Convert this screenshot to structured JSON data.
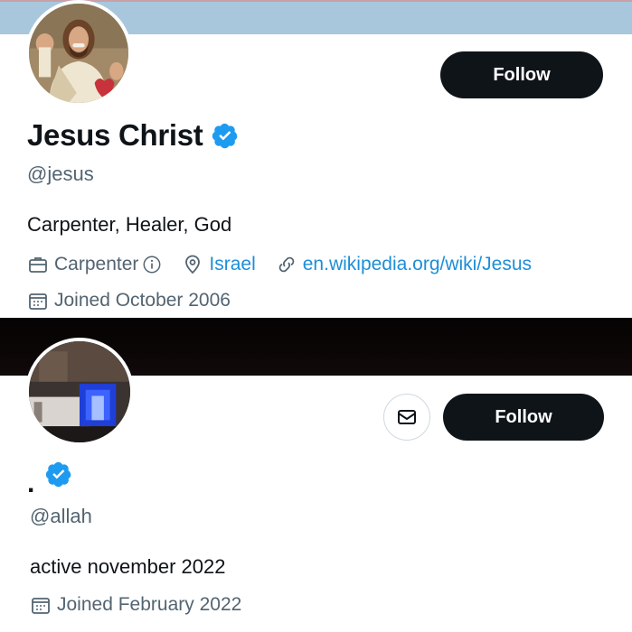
{
  "profile1": {
    "display_name": "Jesus Christ",
    "handle": "@jesus",
    "bio": "Carpenter, Healer, God",
    "follow_label": "Follow",
    "profession": "Carpenter",
    "location": "Israel",
    "website": "en.wikipedia.org/wiki/Jesus",
    "joined": "Joined October 2006",
    "verified": true,
    "avatar_icon": "jesus-portrait",
    "banner_color": "#a8c7dc"
  },
  "profile2": {
    "display_name": ".",
    "handle": "@allah",
    "bio": "active november 2022",
    "follow_label": "Follow",
    "joined": "Joined February 2022",
    "verified": true,
    "avatar_icon": "blue-lit-building-photo",
    "message_icon": "envelope-icon",
    "banner_color": "#050303"
  },
  "colors": {
    "accent": "#1d9bf0",
    "text": "#0f1419",
    "secondary": "#536471",
    "button": "#0f1419"
  }
}
